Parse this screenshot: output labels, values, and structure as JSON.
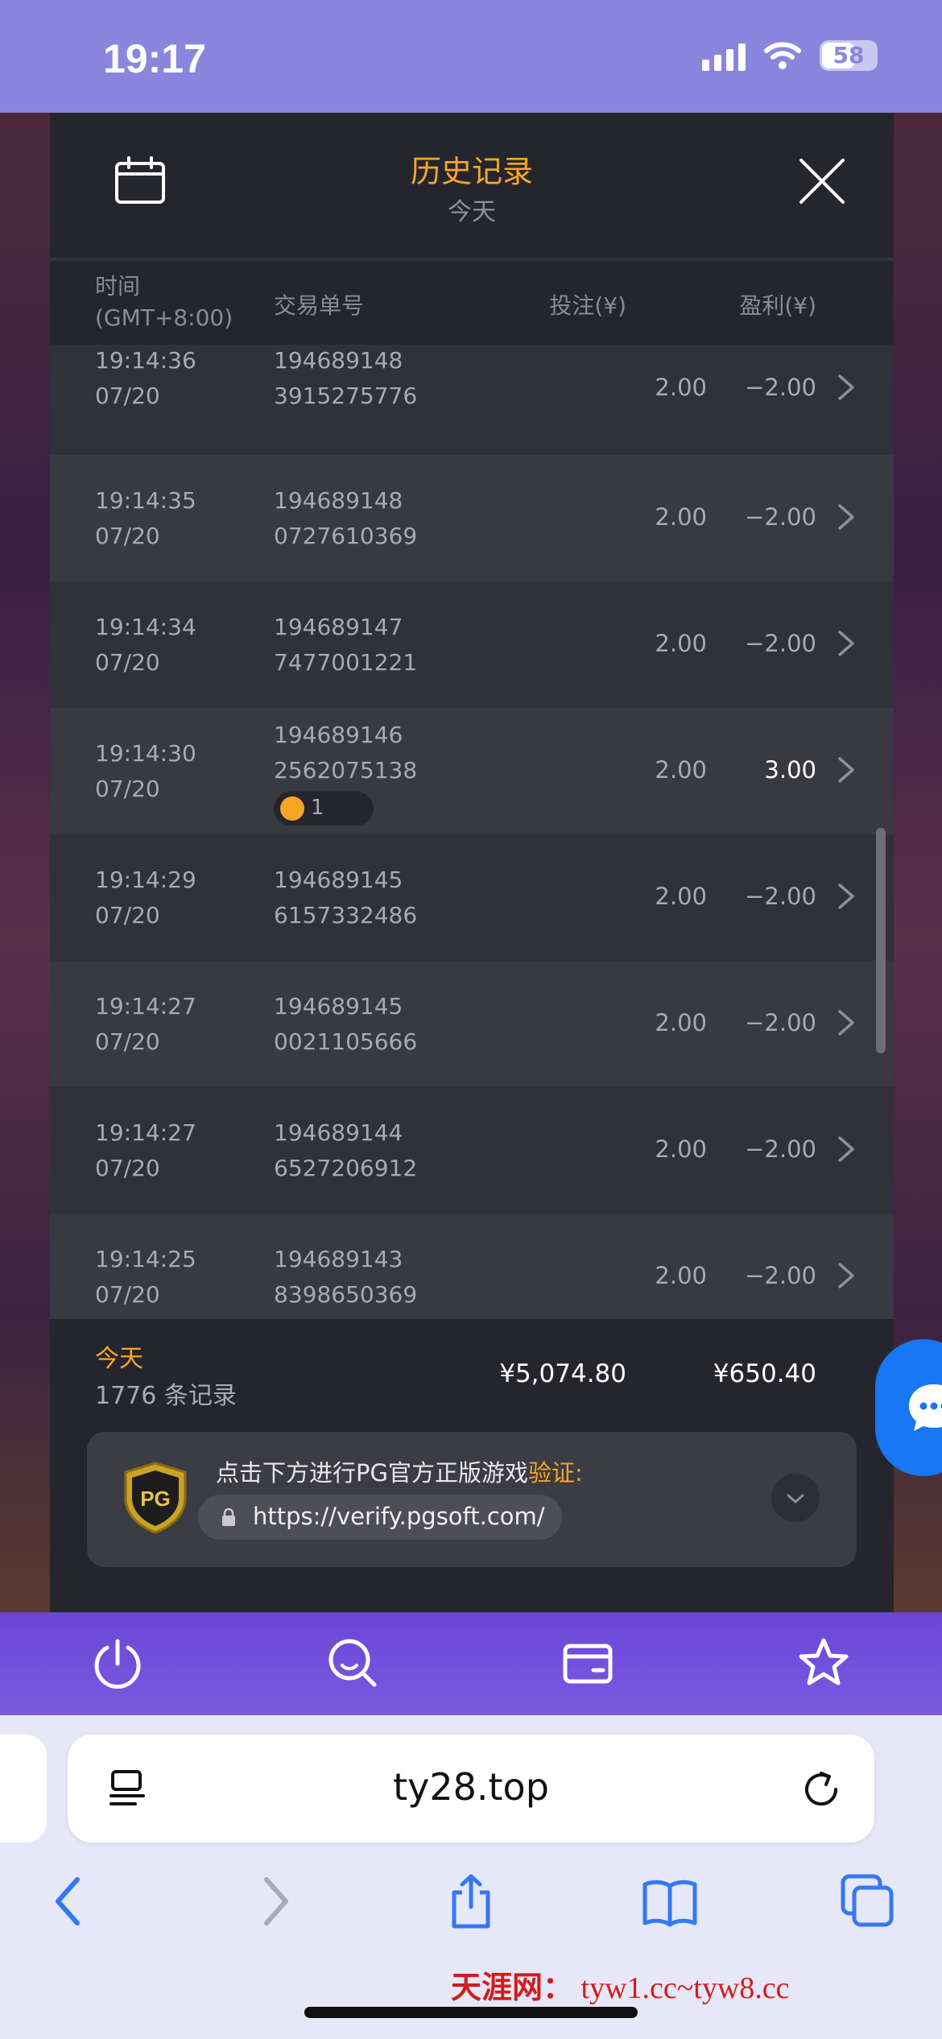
{
  "status_bar": {
    "time": "19:17",
    "battery": "58"
  },
  "panel": {
    "title": "历史记录",
    "subtitle": "今天"
  },
  "columns": {
    "time": "时间",
    "timezone": "(GMT+8:00)",
    "txn": "交易单号",
    "bet": "投注(¥)",
    "profit": "盈利(¥)"
  },
  "rows": [
    {
      "time": "19:14:36",
      "date": "07/20",
      "id1": "194689148",
      "id2": "3915275776",
      "bet": "2.00",
      "profit": "−2.00"
    },
    {
      "time": "19:14:35",
      "date": "07/20",
      "id1": "194689148",
      "id2": "0727610369",
      "bet": "2.00",
      "profit": "−2.00"
    },
    {
      "time": "19:14:34",
      "date": "07/20",
      "id1": "194689147",
      "id2": "7477001221",
      "bet": "2.00",
      "profit": "−2.00"
    },
    {
      "time": "19:14:30",
      "date": "07/20",
      "id1": "194689146",
      "id2": "2562075138",
      "bet": "2.00",
      "profit": "3.00",
      "badge": "1"
    },
    {
      "time": "19:14:29",
      "date": "07/20",
      "id1": "194689145",
      "id2": "6157332486",
      "bet": "2.00",
      "profit": "−2.00"
    },
    {
      "time": "19:14:27",
      "date": "07/20",
      "id1": "194689145",
      "id2": "0021105666",
      "bet": "2.00",
      "profit": "−2.00"
    },
    {
      "time": "19:14:27",
      "date": "07/20",
      "id1": "194689144",
      "id2": "6527206912",
      "bet": "2.00",
      "profit": "−2.00"
    },
    {
      "time": "19:14:25",
      "date": "07/20",
      "id1": "194689143",
      "id2": "8398650369",
      "bet": "2.00",
      "profit": "−2.00"
    }
  ],
  "footer": {
    "today": "今天",
    "count": "1776 条记录",
    "bet_total": "¥5,074.80",
    "profit_total": "¥650.40",
    "verify_text": "点击下方进行PG官方正版游戏",
    "verify_highlight": "验证:",
    "verify_url": "https://verify.pgsoft.com/"
  },
  "toolbar": {
    "icons": [
      "power-icon",
      "search-icon",
      "wallet-icon",
      "star-icon"
    ]
  },
  "browser": {
    "domain": "ty28.top"
  },
  "watermark": {
    "cn": "天涯网：",
    "en": "tyw1.cc~tyw8.cc"
  },
  "colors": {
    "accent": "#f5a623",
    "status_bar": "#8a86dd",
    "toolbar": "#6b46d6",
    "panel": "#303139",
    "chat": "#1877f2"
  }
}
